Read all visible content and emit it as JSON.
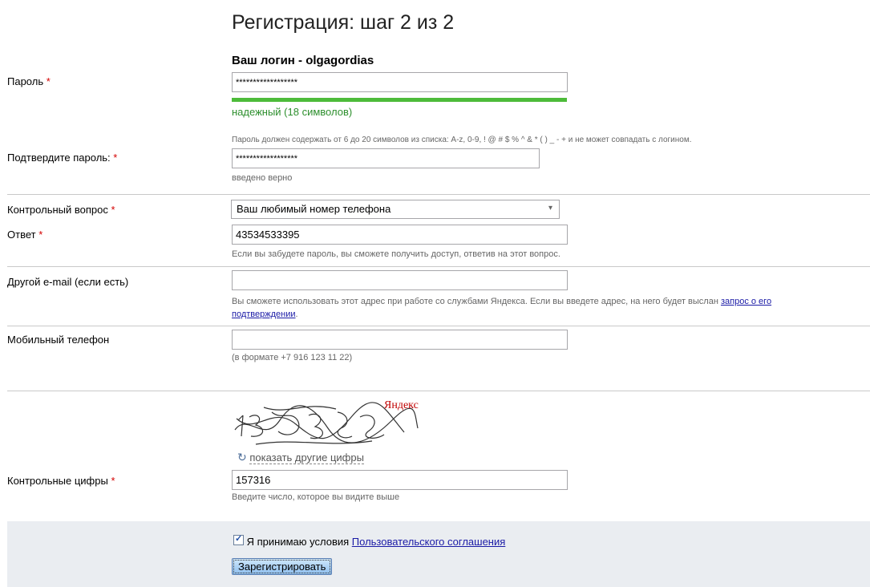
{
  "page": {
    "title": "Регистрация: шаг 2 из 2",
    "login_caption": "Ваш логин - olgagordias"
  },
  "required_mark": "*",
  "password": {
    "label": "Пароль",
    "value": "******************",
    "strength_text": "надежный (18 символов)",
    "strength_fraction": 1.0,
    "rule_hint": "Пароль должен содержать от 6 до 20 символов из списка: A-z, 0-9, ! @ # $ % ^ & * ( ) _ - + и не может совпадать с логином."
  },
  "confirm_password": {
    "label": "Подтвердите пароль:",
    "value": "******************",
    "status": "введено верно"
  },
  "security_question": {
    "label": "Контрольный вопрос",
    "selected": "Ваш любимый номер телефона"
  },
  "answer": {
    "label": "Ответ",
    "value": "43534533395",
    "hint": "Если вы забудете пароль, вы сможете получить доступ, ответив на этот вопрос."
  },
  "other_email": {
    "label": "Другой e-mail (если есть)",
    "value": "",
    "hint_before": "Вы сможете использовать этот адрес при работе со службами Яндекса. Если вы введете адрес, на него будет выслан",
    "hint_link_line1": "запрос о его",
    "hint_link_line2": "подтверждении",
    "hint_after": "."
  },
  "mobile": {
    "label": "Мобильный телефон",
    "value": "",
    "hint": "(в формате +7 916 123 11 22)"
  },
  "captcha": {
    "brand_text": "Яндекс",
    "refresh_link": "показать другие цифры",
    "label": "Контрольные цифры",
    "value": "157316",
    "hint": "Введите число, которое вы видите выше"
  },
  "agreement": {
    "checked": true,
    "text": "Я принимаю условия",
    "link": "Пользовательского соглашения"
  },
  "submit_label": "Зарегистрировать",
  "colors": {
    "required": "#d40000",
    "strength_green": "#4dbb3a",
    "link_blue": "#1a1aa6",
    "panel_bg": "#eaedf1"
  }
}
